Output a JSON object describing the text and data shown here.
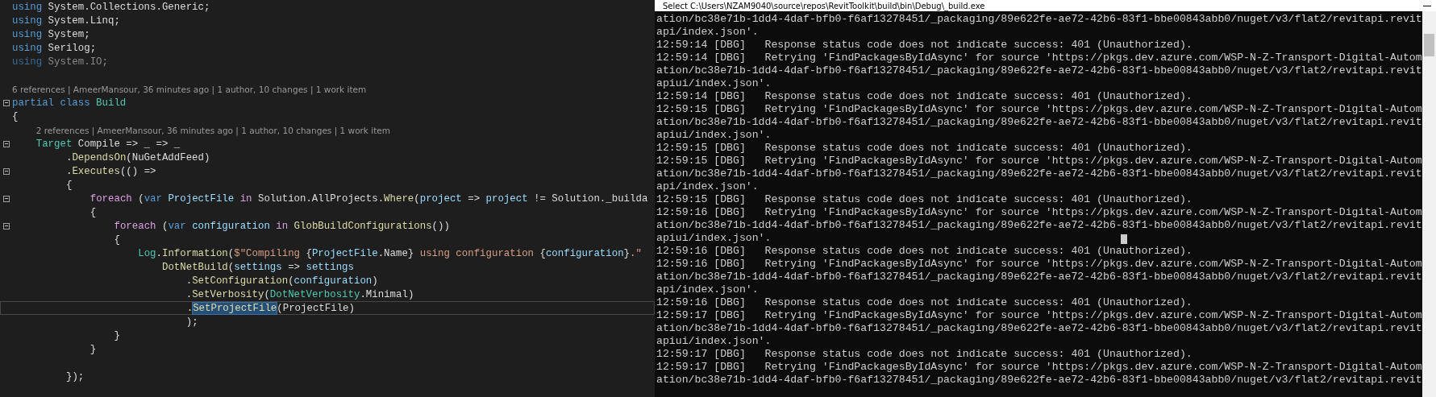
{
  "editor": {
    "lines": [
      {
        "kind": "code",
        "tokens": [
          {
            "text": "using",
            "kind": "keyword"
          },
          {
            "text": " System.Collections.Generic;",
            "kind": "plain"
          }
        ]
      },
      {
        "kind": "code",
        "tokens": [
          {
            "text": "using",
            "kind": "keyword"
          },
          {
            "text": " System.Linq;",
            "kind": "plain"
          }
        ]
      },
      {
        "kind": "code",
        "tokens": [
          {
            "text": "using",
            "kind": "keyword"
          },
          {
            "text": " System;",
            "kind": "plain"
          }
        ]
      },
      {
        "kind": "code",
        "tokens": [
          {
            "text": "using",
            "kind": "keyword"
          },
          {
            "text": " Serilog;",
            "kind": "plain"
          }
        ]
      },
      {
        "kind": "code",
        "tokens": [
          {
            "text": "using",
            "kind": "unused-keyword"
          },
          {
            "text": " System.IO;",
            "kind": "unused"
          }
        ]
      },
      {
        "kind": "blank"
      },
      {
        "kind": "lens",
        "text": "6 references | AmeerMansour, 36 minutes ago | 1 author, 10 changes | 1 work item"
      },
      {
        "kind": "block",
        "tokens": [
          {
            "text": "partial class",
            "kind": "keyword"
          },
          {
            "text": " Build",
            "kind": "type"
          }
        ]
      },
      {
        "kind": "code",
        "tokens": [
          {
            "text": "{",
            "kind": "plain"
          }
        ],
        "children": [
          {
            "kind": "lens",
            "text": "2 references | AmeerMansour, 36 minutes ago | 1 author, 10 changes | 1 work item"
          },
          {
            "kind": "block",
            "tokens": [
              {
                "text": "Target",
                "kind": "type"
              },
              {
                "text": " Compile => _ => _",
                "kind": "plain"
              }
            ],
            "children": [
              {
                "kind": "code",
                "tokens": [
                  {
                    "text": ".",
                    "kind": "plain"
                  },
                  {
                    "text": "DependsOn",
                    "kind": "method"
                  },
                  {
                    "text": "(NuGetAddFeed)",
                    "kind": "plain"
                  }
                ]
              },
              {
                "kind": "block",
                "tokens": [
                  {
                    "text": ".",
                    "kind": "plain"
                  },
                  {
                    "text": "Executes",
                    "kind": "method"
                  },
                  {
                    "text": "(() =>",
                    "kind": "plain"
                  }
                ]
              },
              {
                "kind": "code",
                "tokens": [
                  {
                    "text": "{",
                    "kind": "plain"
                  }
                ],
                "children": [
                  {
                    "kind": "block",
                    "tokens": [
                      {
                        "text": "foreach",
                        "kind": "control"
                      },
                      {
                        "text": " (",
                        "kind": "plain"
                      },
                      {
                        "text": "var",
                        "kind": "keyword"
                      },
                      {
                        "text": " ProjectFile",
                        "kind": "variable"
                      },
                      {
                        "text": " in",
                        "kind": "control"
                      },
                      {
                        "text": " Solution.AllProjects.",
                        "kind": "plain"
                      },
                      {
                        "text": "Where",
                        "kind": "method"
                      },
                      {
                        "text": "(",
                        "kind": "plain"
                      },
                      {
                        "text": "project",
                        "kind": "variable"
                      },
                      {
                        "text": " => ",
                        "kind": "plain"
                      },
                      {
                        "text": "project",
                        "kind": "variable"
                      },
                      {
                        "text": " != Solution._builda",
                        "kind": "plain"
                      }
                    ]
                  },
                  {
                    "kind": "code",
                    "tokens": [
                      {
                        "text": "{",
                        "kind": "plain"
                      }
                    ],
                    "children": [
                      {
                        "kind": "block",
                        "tokens": [
                          {
                            "text": "foreach",
                            "kind": "control"
                          },
                          {
                            "text": " (",
                            "kind": "plain"
                          },
                          {
                            "text": "var",
                            "kind": "keyword"
                          },
                          {
                            "text": " configuration",
                            "kind": "variable"
                          },
                          {
                            "text": " in",
                            "kind": "control"
                          },
                          {
                            "text": " GlobBuildConfigurations",
                            "kind": "method"
                          },
                          {
                            "text": "())",
                            "kind": "plain"
                          }
                        ]
                      },
                      {
                        "kind": "code",
                        "tokens": [
                          {
                            "text": "{",
                            "kind": "plain"
                          }
                        ],
                        "children": [
                          {
                            "kind": "code",
                            "tokens": [
                              {
                                "text": "Log",
                                "kind": "type"
                              },
                              {
                                "text": ".",
                                "kind": "plain"
                              },
                              {
                                "text": "Information",
                                "kind": "method"
                              },
                              {
                                "text": "(",
                                "kind": "plain"
                              },
                              {
                                "text": "$\"Compiling ",
                                "kind": "string"
                              },
                              {
                                "text": "{",
                                "kind": "plain"
                              },
                              {
                                "text": "ProjectFile",
                                "kind": "variable"
                              },
                              {
                                "text": ".Name}",
                                "kind": "plain"
                              },
                              {
                                "text": " using configuration ",
                                "kind": "string"
                              },
                              {
                                "text": "{",
                                "kind": "plain"
                              },
                              {
                                "text": "configuration",
                                "kind": "variable"
                              },
                              {
                                "text": "}",
                                "kind": "plain"
                              },
                              {
                                "text": ".\"",
                                "kind": "string"
                              }
                            ],
                            "children": [
                              {
                                "kind": "code",
                                "tokens": [
                                  {
                                    "text": "DotNetBuild",
                                    "kind": "method"
                                  },
                                  {
                                    "text": "(",
                                    "kind": "plain"
                                  },
                                  {
                                    "text": "settings",
                                    "kind": "variable"
                                  },
                                  {
                                    "text": " => ",
                                    "kind": "plain"
                                  },
                                  {
                                    "text": "settings",
                                    "kind": "variable"
                                  }
                                ],
                                "children": [
                                  {
                                    "kind": "code",
                                    "tokens": [
                                      {
                                        "text": ".",
                                        "kind": "plain"
                                      },
                                      {
                                        "text": "SetConfiguration",
                                        "kind": "method"
                                      },
                                      {
                                        "text": "(",
                                        "kind": "plain"
                                      },
                                      {
                                        "text": "configuration",
                                        "kind": "variable"
                                      },
                                      {
                                        "text": ")",
                                        "kind": "plain"
                                      }
                                    ]
                                  },
                                  {
                                    "kind": "code",
                                    "tokens": [
                                      {
                                        "text": ".",
                                        "kind": "plain"
                                      },
                                      {
                                        "text": "SetVerbosity",
                                        "kind": "method"
                                      },
                                      {
                                        "text": "(",
                                        "kind": "plain"
                                      },
                                      {
                                        "text": "DotNetVerbosity",
                                        "kind": "type"
                                      },
                                      {
                                        "text": ".Minimal)",
                                        "kind": "plain"
                                      }
                                    ]
                                  },
                                  {
                                    "kind": "current",
                                    "tokens": [
                                      {
                                        "text": ".",
                                        "kind": "plain"
                                      },
                                      {
                                        "text": "SetProjectFile",
                                        "kind": "match"
                                      },
                                      {
                                        "text": "(ProjectFile)",
                                        "kind": "plain"
                                      }
                                    ]
                                  },
                                  {
                                    "kind": "code",
                                    "tokens": [
                                      {
                                        "text": ");",
                                        "kind": "plain"
                                      }
                                    ]
                                  }
                                ]
                              }
                            ]
                          }
                        ]
                      },
                      {
                        "kind": "code",
                        "tokens": [
                          {
                            "text": "}",
                            "kind": "plain"
                          }
                        ]
                      }
                    ]
                  },
                  {
                    "kind": "code",
                    "tokens": [
                      {
                        "text": "}",
                        "kind": "plain"
                      }
                    ]
                  },
                  {
                    "kind": "blank"
                  }
                ]
              },
              {
                "kind": "code",
                "tokens": [
                  {
                    "text": "});",
                    "kind": "plain"
                  }
                ]
              }
            ]
          }
        ]
      }
    ]
  },
  "console": {
    "title": "Select C:\\Users\\NZAM9040\\source\\repos\\RevitToolkit\\build\\bin\\Debug\\_build.exe",
    "lines": [
      "ation/bc38e71b-1dd4-4daf-bfb0-f6af13278451/_packaging/89e622fe-ae72-42b6-83f1-bbe00843abb0/nuget/v3/flat2/revitapi.revit",
      "api/index.json'.",
      "12:59:14 [DBG]   Response status code does not indicate success: 401 (Unauthorized).",
      "12:59:14 [DBG]   Retrying 'FindPackagesByIdAsync' for source 'https://pkgs.dev.azure.com/WSP-N-Z-Transport-Digital-Autom",
      "ation/bc38e71b-1dd4-4daf-bfb0-f6af13278451/_packaging/89e622fe-ae72-42b6-83f1-bbe00843abb0/nuget/v3/flat2/revitapi.revit",
      "apiui/index.json'.",
      "12:59:14 [DBG]   Response status code does not indicate success: 401 (Unauthorized).",
      "12:59:15 [DBG]   Retrying 'FindPackagesByIdAsync' for source 'https://pkgs.dev.azure.com/WSP-N-Z-Transport-Digital-Autom",
      "ation/bc38e71b-1dd4-4daf-bfb0-f6af13278451/_packaging/89e622fe-ae72-42b6-83f1-bbe00843abb0/nuget/v3/flat2/revitapi.revit",
      "apiui/index.json'.",
      "12:59:15 [DBG]   Response status code does not indicate success: 401 (Unauthorized).",
      "12:59:15 [DBG]   Retrying 'FindPackagesByIdAsync' for source 'https://pkgs.dev.azure.com/WSP-N-Z-Transport-Digital-Autom",
      "ation/bc38e71b-1dd4-4daf-bfb0-f6af13278451/_packaging/89e622fe-ae72-42b6-83f1-bbe00843abb0/nuget/v3/flat2/revitapi.revit",
      "api/index.json'.",
      "12:59:15 [DBG]   Response status code does not indicate success: 401 (Unauthorized).",
      "12:59:16 [DBG]   Retrying 'FindPackagesByIdAsync' for source 'https://pkgs.dev.azure.com/WSP-N-Z-Transport-Digital-Autom",
      "ation/bc38e71b-1dd4-4daf-bfb0-f6af13278451/_packaging/89e622fe-ae72-42b6-83f1-bbe00843abb0/nuget/v3/flat2/revitapi.revit",
      "apiui/index.json'.",
      "12:59:16 [DBG]   Response status code does not indicate success: 401 (Unauthorized).",
      "12:59:16 [DBG]   Retrying 'FindPackagesByIdAsync' for source 'https://pkgs.dev.azure.com/WSP-N-Z-Transport-Digital-Autom",
      "ation/bc38e71b-1dd4-4daf-bfb0-f6af13278451/_packaging/89e622fe-ae72-42b6-83f1-bbe00843abb0/nuget/v3/flat2/revitapi.revit",
      "api/index.json'.",
      "12:59:16 [DBG]   Response status code does not indicate success: 401 (Unauthorized).",
      "12:59:17 [DBG]   Retrying 'FindPackagesByIdAsync' for source 'https://pkgs.dev.azure.com/WSP-N-Z-Transport-Digital-Autom",
      "ation/bc38e71b-1dd4-4daf-bfb0-f6af13278451/_packaging/89e622fe-ae72-42b6-83f1-bbe00843abb0/nuget/v3/flat2/revitapi.revit",
      "apiui/index.json'.",
      "12:59:17 [DBG]   Response status code does not indicate success: 401 (Unauthorized).",
      "12:59:17 [DBG]   Retrying 'FindPackagesByIdAsync' for source 'https://pkgs.dev.azure.com/WSP-N-Z-Transport-Digital-Autom",
      "ation/bc38e71b-1dd4-4daf-bfb0-f6af13278451/_packaging/89e622fe-ae72-42b6-83f1-bbe00843abb0/nuget/v3/flat2/revitapi.revit"
    ]
  }
}
